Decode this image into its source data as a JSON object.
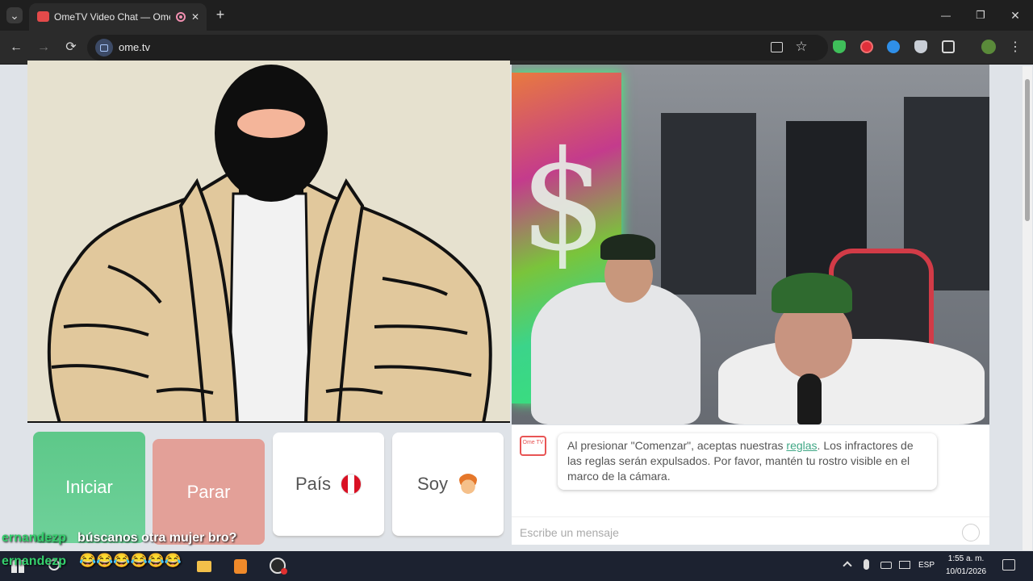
{
  "browser": {
    "tab_title": "OmeTV Video Chat — Ome",
    "url": "ome.tv",
    "new_tab_glyph": "+",
    "close_tab_glyph": "✕",
    "back_glyph": "←",
    "forward_glyph": "→",
    "reload_glyph": "⟳",
    "minimize_glyph": "—",
    "maximize_glyph": "❐",
    "close_window_glyph": "✕",
    "tab_search_glyph": "⌄",
    "bookmark_glyph": "☆",
    "menu_glyph": "⋮"
  },
  "controls": {
    "start_label": "Iniciar",
    "stop_label": "Parar",
    "country_label": "País",
    "gender_label": "Soy"
  },
  "chat": {
    "logo_text": "Ome TV",
    "notice_prefix": "Al presionar \"Comenzar\", aceptas nuestras ",
    "notice_link": "reglas",
    "notice_suffix": ". Los infractores de las reglas serán expulsados. Por favor, mantén tu rostro visible en el marco de la cámara.",
    "input_placeholder": "Escribe un mensaje"
  },
  "overlay": {
    "line1_user": "ernandezp",
    "line1_text": "búscanos otra mujer bro?",
    "line2_user": "ernandezp",
    "line2_text": "😂😂😂😂😂😂"
  },
  "taskbar": {
    "language": "ESP",
    "time": "1:55 a. m.",
    "date": "10/01/2026"
  },
  "colors": {
    "start_button": "#5dc889",
    "stop_button": "#e3a098",
    "link": "#3fa785",
    "overlay_user": "#35d06d"
  }
}
